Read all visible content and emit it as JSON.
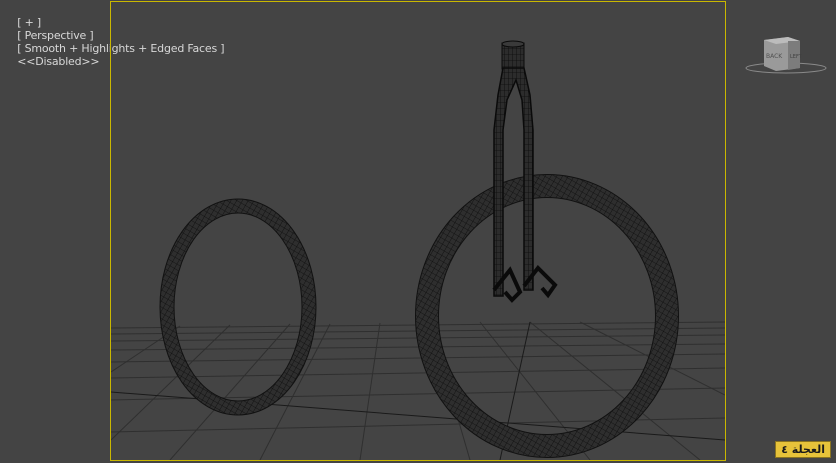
{
  "viewport": {
    "label_plus": "[ + ]",
    "label_view": "[ Perspective ]",
    "label_shading": "[ Smooth + Highlights + Edged Faces ]",
    "label_status": "<<Disabled>>"
  },
  "viewcube": {
    "face_front": "BACK",
    "face_side": "LEFT"
  },
  "badge": {
    "text": "العجلة ٤"
  },
  "colors": {
    "background": "#444444",
    "safe_frame": "#c9b700",
    "badge": "#e7c33a"
  }
}
